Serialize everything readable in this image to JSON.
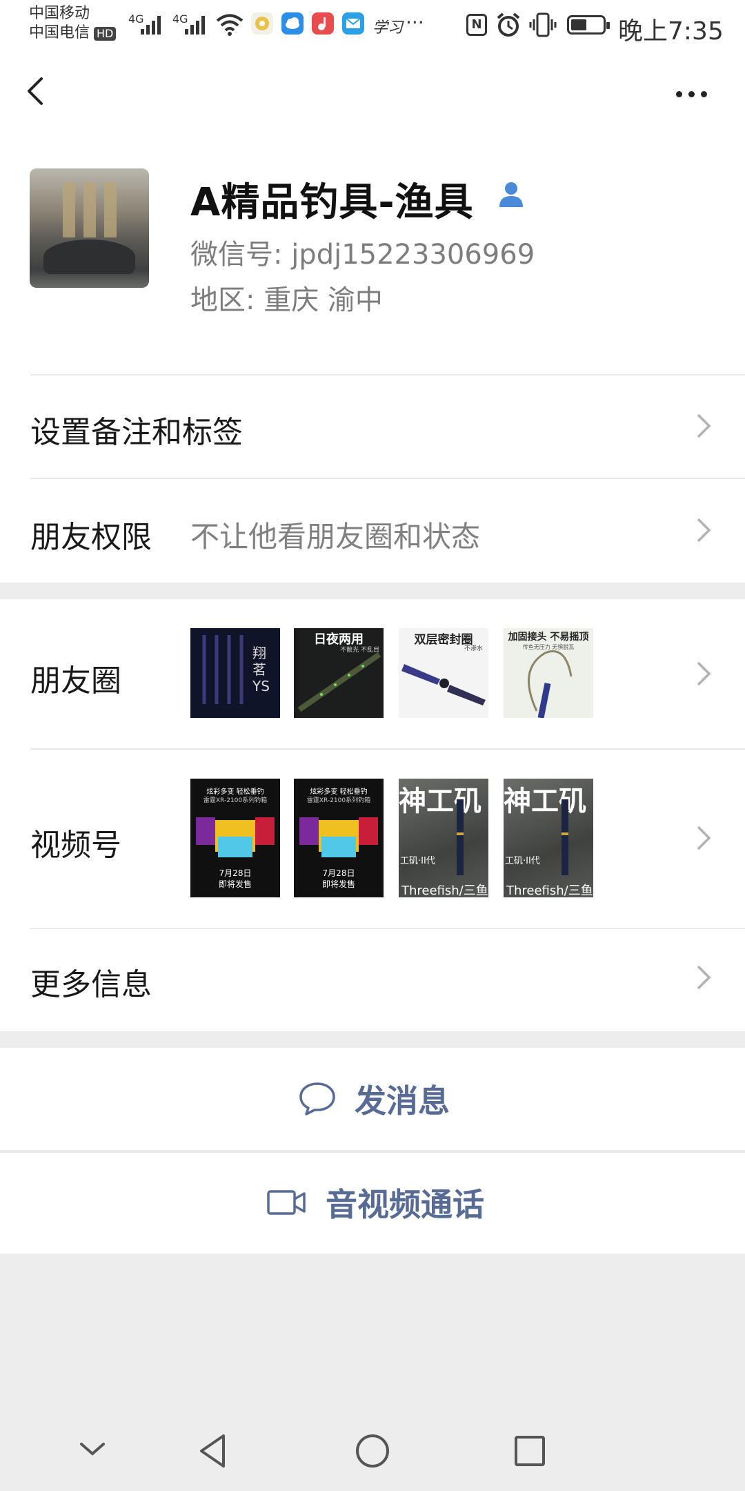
{
  "status_bar": {
    "carrier1": "中国移动",
    "carrier2": "中国电信",
    "hd": "HD",
    "net1": "4G",
    "net2": "4G",
    "app_text": "学习",
    "overflow": "···",
    "nfc": "N",
    "time": "晚上7:35"
  },
  "profile": {
    "name": "A精品钓具-渔具",
    "wechat_id": "微信号: jpdj15223306969",
    "region": "地区: 重庆  渝中"
  },
  "rows": {
    "remark_label": "设置备注和标签",
    "permission_label": "朋友权限",
    "permission_value": "不让他看朋友圈和状态",
    "moments_label": "朋友圈",
    "channels_label": "视频号",
    "more_info_label": "更多信息"
  },
  "moments_thumbs": {
    "t1_text": "翔茗YS",
    "t2_text": "日夜两用",
    "t2_sub": "不散光 不乱目",
    "t3_text": "双层密封圈",
    "t3_sub": "不渗水",
    "t4_text": "加固接头 不易摇顶",
    "t4_sub": "传鱼无压力  无惧脱瓦"
  },
  "channels_thumbs": {
    "v1_top": "炫彩多变  轻松垂钓",
    "v1_mid": "雷霆XR-2100系列钓箱",
    "v1_date": "7月28日",
    "v1_release": "即将发售",
    "v3_top": "神工矶",
    "v3_mid": "工矶·II代",
    "v3_brand": "Threefish/三鱼"
  },
  "actions": {
    "message": "发消息",
    "call": "音视频通话"
  },
  "colors": {
    "link": "#576b95",
    "accent_blue": "#4a8ad8",
    "background": "#ededed"
  }
}
